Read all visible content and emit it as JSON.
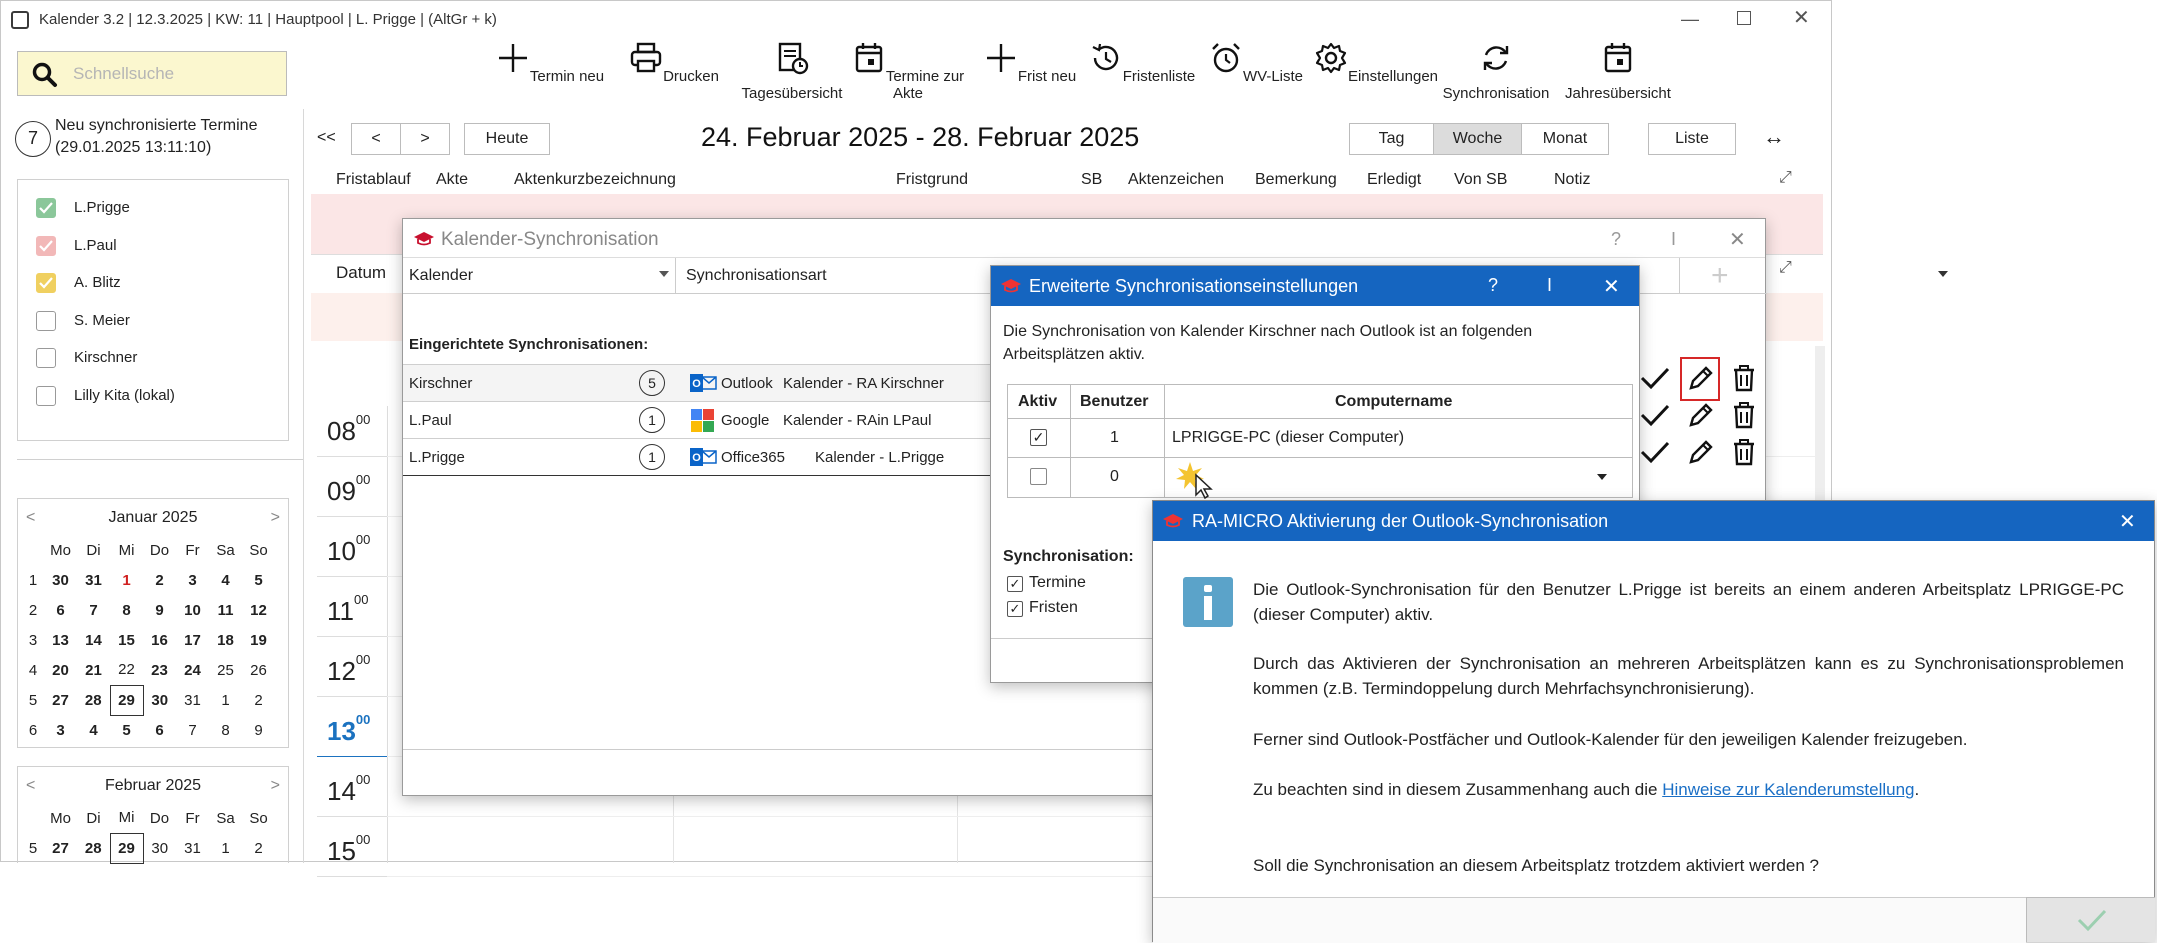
{
  "window": {
    "title": "Kalender 3.2 | 12.3.2025 | KW: 11 | Hauptpool | L. Prigge | (AltGr + k)"
  },
  "search": {
    "placeholder": "Schnellsuche"
  },
  "toolbar": [
    {
      "label": "Termin neu",
      "icon": "plus-icon"
    },
    {
      "label": "Drucken",
      "icon": "printer-icon"
    },
    {
      "label": "Tagesübersicht",
      "icon": "document-clock-icon"
    },
    {
      "label": "Termine zur Akte",
      "icon": "calendar-icon"
    },
    {
      "label": "Frist neu",
      "icon": "plus-icon"
    },
    {
      "label": "Fristenliste",
      "icon": "history-icon"
    },
    {
      "label": "WV-Liste",
      "icon": "alarm-icon"
    },
    {
      "label": "Einstellungen",
      "icon": "gear-icon"
    },
    {
      "label": "Synchronisation",
      "icon": "sync-icon"
    },
    {
      "label": "Jahresübersicht",
      "icon": "calendar-icon"
    }
  ],
  "sync_notice": {
    "count": "7",
    "line1": "Neu synchronisierte Termine",
    "line2": "(29.01.2025 13:11:10)"
  },
  "calendars": [
    {
      "label": "L.Prigge",
      "checked": true,
      "color": "#8bc79a"
    },
    {
      "label": "L.Paul",
      "checked": true,
      "color": "#f2b8b8"
    },
    {
      "label": "A. Blitz",
      "checked": true,
      "color": "#f0d060"
    },
    {
      "label": "S. Meier",
      "checked": false
    },
    {
      "label": "Kirschner",
      "checked": false
    },
    {
      "label": "Lilly Kita (lokal)",
      "checked": false
    }
  ],
  "nav": {
    "first": "<<",
    "prev": "<",
    "next": ">",
    "today": "Heute",
    "range": "24. Februar 2025 - 28. Februar 2025",
    "views": [
      "Tag",
      "Woche",
      "Monat"
    ],
    "active_view": "Woche",
    "list": "Liste",
    "swap": "↔"
  },
  "columns": [
    "Fristablauf",
    "Akte",
    "Aktenkurzbezeichnung",
    "Fristgrund",
    "SB",
    "Aktenzeichen",
    "Bemerkung",
    "Erledigt",
    "Von SB",
    "Notiz"
  ],
  "date_col": "Datum",
  "hours": [
    {
      "h": "08",
      "m": "00"
    },
    {
      "h": "09",
      "m": "00"
    },
    {
      "h": "10",
      "m": "00"
    },
    {
      "h": "11",
      "m": "00"
    },
    {
      "h": "12",
      "m": "00"
    },
    {
      "h": "13",
      "m": "00"
    },
    {
      "h": "14",
      "m": "00"
    },
    {
      "h": "15",
      "m": "00"
    }
  ],
  "mini_cal_jan": {
    "title": "Januar 2025",
    "prev": "<",
    "next": ">",
    "weekdays": [
      "Mo",
      "Di",
      "Mi",
      "Do",
      "Fr",
      "Sa",
      "So"
    ],
    "weeks": [
      {
        "kw": "1",
        "days": [
          "30",
          "31",
          "1",
          "2",
          "3",
          "4",
          "5"
        ]
      },
      {
        "kw": "2",
        "days": [
          "6",
          "7",
          "8",
          "9",
          "10",
          "11",
          "12"
        ]
      },
      {
        "kw": "3",
        "days": [
          "13",
          "14",
          "15",
          "16",
          "17",
          "18",
          "19"
        ]
      },
      {
        "kw": "4",
        "days": [
          "20",
          "21",
          "22",
          "23",
          "24",
          "25",
          "26"
        ]
      },
      {
        "kw": "5",
        "days": [
          "27",
          "28",
          "29",
          "30",
          "31",
          "1",
          "2"
        ]
      },
      {
        "kw": "6",
        "days": [
          "3",
          "4",
          "5",
          "6",
          "7",
          "8",
          "9"
        ]
      }
    ]
  },
  "mini_cal_feb": {
    "title": "Februar 2025",
    "prev": "<",
    "next": ">",
    "weekdays": [
      "Mo",
      "Di",
      "Mi",
      "Do",
      "Fr",
      "Sa",
      "So"
    ],
    "weeks": [
      {
        "kw": "5",
        "days": [
          "27",
          "28",
          "29",
          "30",
          "31",
          "1",
          "2"
        ]
      }
    ]
  },
  "sync_dialog": {
    "title": "Kalender-Synchronisation",
    "help": "?",
    "pin": "I",
    "close": "✕",
    "col_kalender": "Kalender",
    "col_syncart": "Synchronisationsart",
    "section": "Eingerichtete Synchronisationen:",
    "rows": [
      {
        "name": "Kirschner",
        "count": "5",
        "service": "Outlook",
        "target": "Kalender - RA Kirschner"
      },
      {
        "name": "L.Paul",
        "count": "1",
        "service": "Google",
        "target": "Kalender - RAin LPaul"
      },
      {
        "name": "L.Prigge",
        "count": "1",
        "service": "Office365",
        "target": "Kalender - L.Prigge"
      }
    ]
  },
  "ext_dialog": {
    "title": "Erweiterte Synchronisationseinstellungen",
    "help": "?",
    "pin": "I",
    "close": "✕",
    "intro": "Die Synchronisation von Kalender Kirschner nach Outlook ist an folgenden Arbeitsplätzen aktiv.",
    "headers": [
      "Aktiv",
      "Benutzer",
      "Computername"
    ],
    "rows": [
      {
        "active": true,
        "user": "1",
        "computer": "LPRIGGE-PC (dieser Computer)"
      },
      {
        "active": false,
        "user": "0",
        "computer": ""
      }
    ],
    "sync_label": "Synchronisation:",
    "opt1": "Termine",
    "opt2": "Fristen"
  },
  "activation_dialog": {
    "title": "RA-MICRO Aktivierung der Outlook-Synchronisation",
    "close": "✕",
    "p1": "Die Outlook-Synchronisation für den Benutzer L.Prigge ist bereits an einem anderen Arbeitsplatz LPRIGGE-PC (dieser Computer) aktiv.",
    "p2": "Durch das Aktivieren der Synchronisation an mehreren Arbeitsplätzen kann es zu Synchronisationsproblemen kommen (z.B. Termindoppelung durch Mehrfachsynchronisierung).",
    "p3": "Ferner sind Outlook-Postfächer und Outlook-Kalender für den jeweiligen Kalender freizugeben.",
    "p4_pre": "Zu beachten sind in diesem Zusammenhang auch die ",
    "p4_link": "Hinweise zur Kalenderumstellung",
    "p4_post": ".",
    "p5": "Soll die Synchronisation an diesem Arbeitsplatz trotzdem aktiviert werden ?"
  }
}
